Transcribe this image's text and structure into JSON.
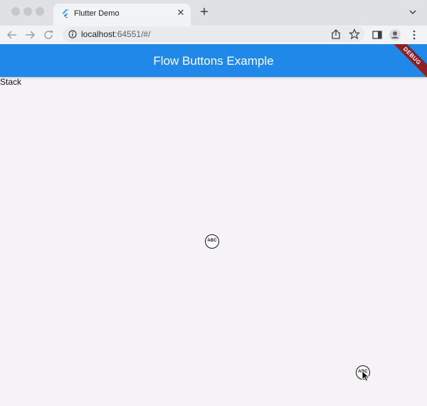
{
  "browser": {
    "tab": {
      "title": "Flutter Demo",
      "close_label": "✕"
    },
    "new_tab_label": "+",
    "address": {
      "host": "localhost",
      "rest": ":64551/#/"
    }
  },
  "app": {
    "appbar_title": "Flow Buttons Example",
    "debug_banner": "DEBUG",
    "stack_label": "Stack",
    "buttons": [
      {
        "label": "ABC"
      },
      {
        "label": "ABC"
      }
    ]
  },
  "colors": {
    "appbar": "#1f88e8",
    "debug_banner": "#8a1f26",
    "background": "#f6f3f6"
  }
}
